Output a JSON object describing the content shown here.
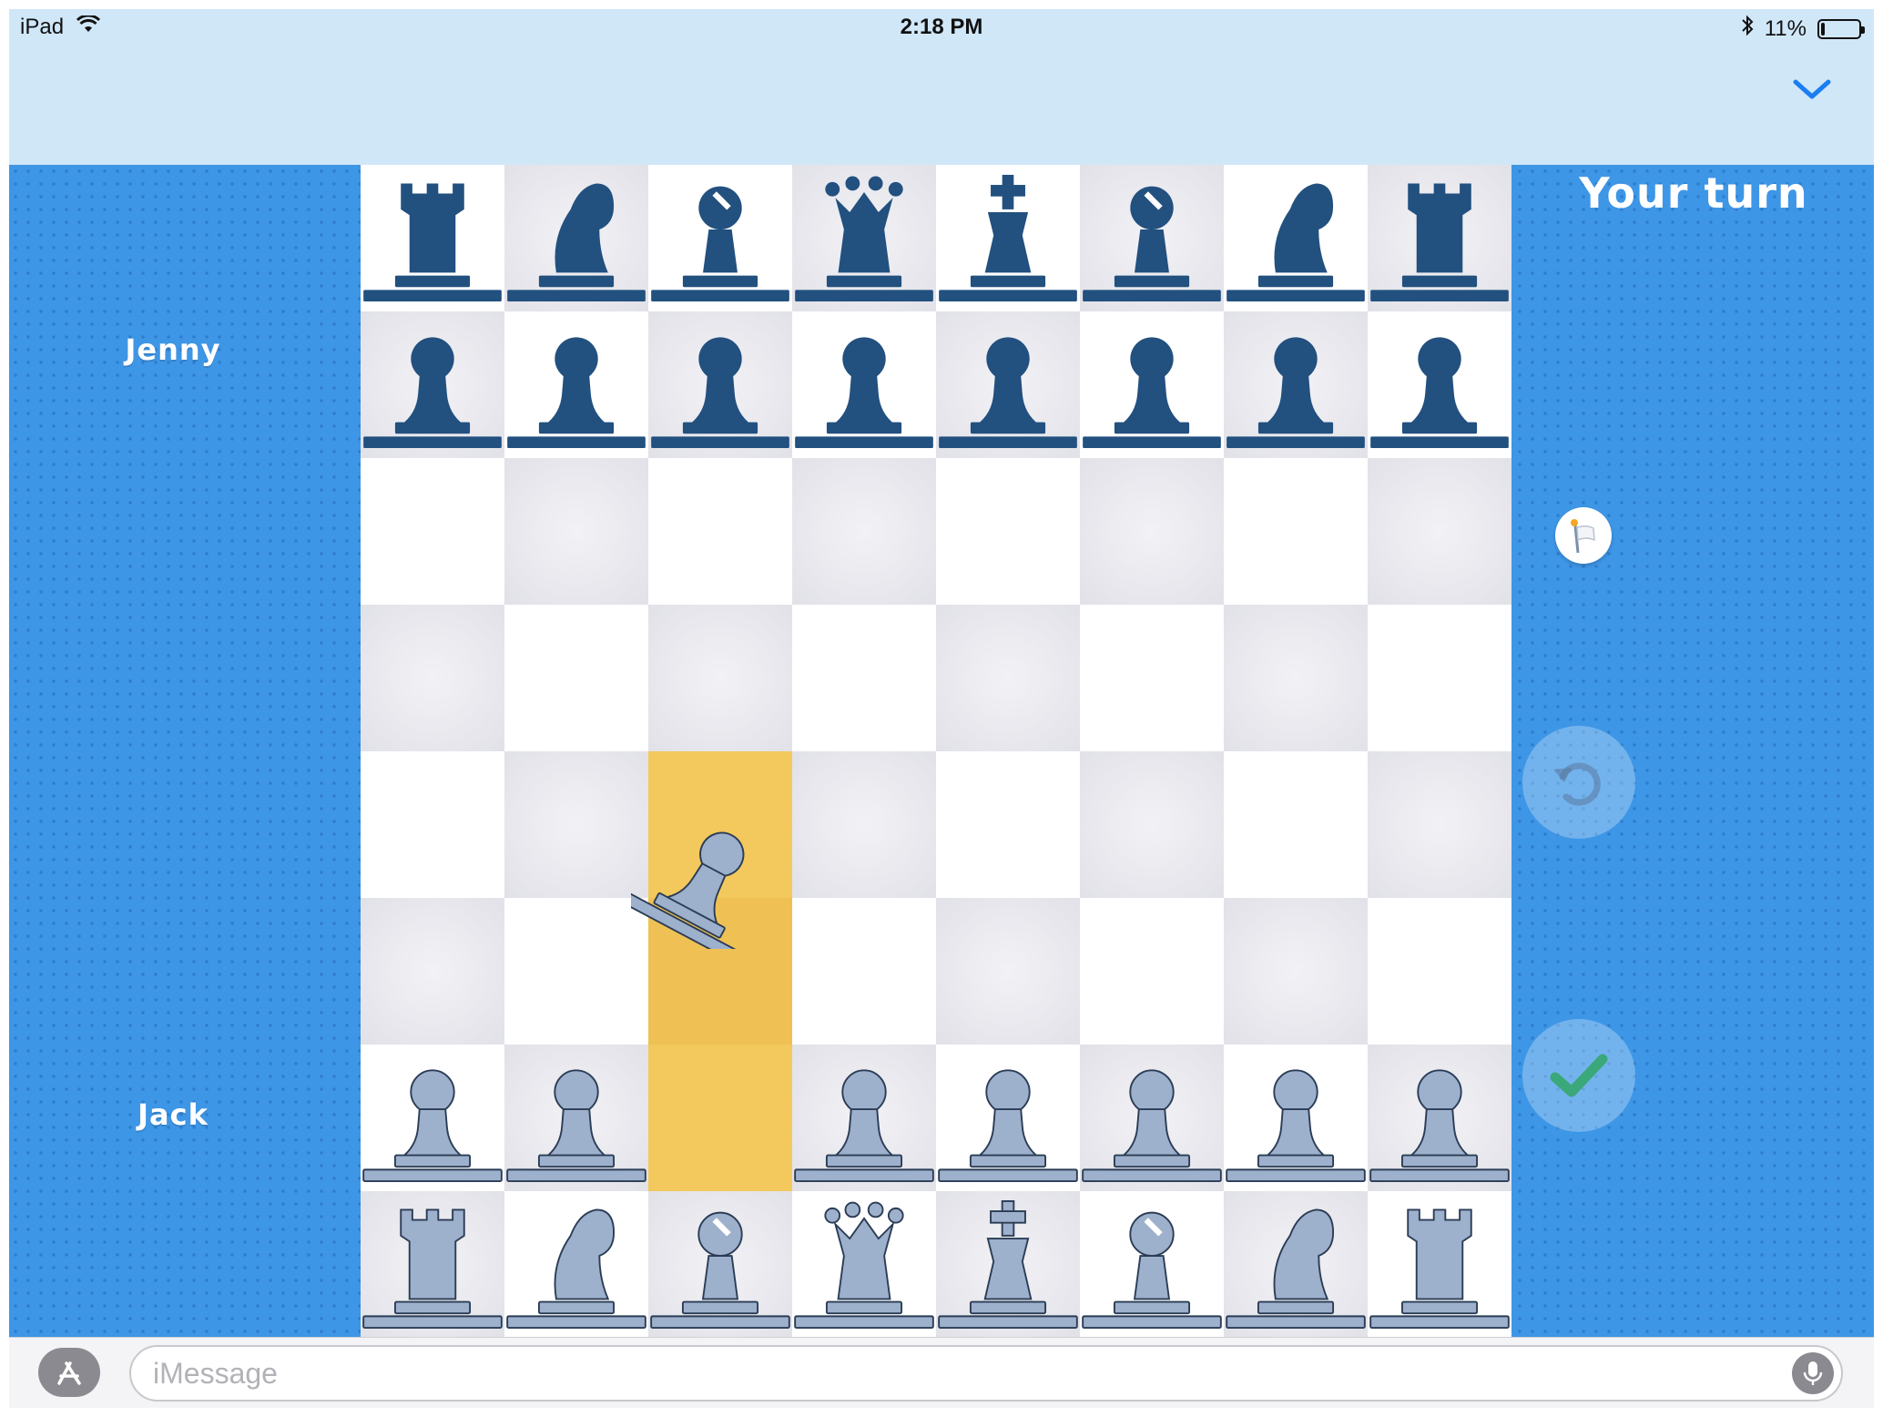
{
  "status_bar": {
    "device": "iPad",
    "time": "2:18 PM",
    "battery": "11%",
    "battery_level": 0.11,
    "icons": [
      "wifi-icon",
      "bluetooth-icon",
      "battery-icon"
    ]
  },
  "header": {
    "collapse_icon": "chevron-down-icon",
    "accent": "#1a7ef2"
  },
  "game": {
    "turn_label": "Your turn",
    "players": {
      "opponent": "Jenny",
      "self": "Jack"
    },
    "colors": {
      "background": "#3e96e6",
      "opponent_pieces": "#22507f",
      "self_pieces": "#9db0cc",
      "highlight": "#f3c85c",
      "confirm": "#3aa87a"
    },
    "board": {
      "rows": [
        [
          "bR",
          "bN",
          "bB",
          "bQ",
          "bK",
          "bB",
          "bN",
          "bR"
        ],
        [
          "bP",
          "bP",
          "bP",
          "bP",
          "bP",
          "bP",
          "bP",
          "bP"
        ],
        [
          "",
          "",
          "",
          "",
          "",
          "",
          "",
          ""
        ],
        [
          "",
          "",
          "",
          "",
          "",
          "",
          "",
          ""
        ],
        [
          "",
          "",
          "",
          "",
          "",
          "",
          "",
          ""
        ],
        [
          "",
          "",
          "",
          "",
          "",
          "",
          "",
          ""
        ],
        [
          "wP",
          "wP",
          "",
          "wP",
          "wP",
          "wP",
          "wP",
          "wP"
        ],
        [
          "wR",
          "wN",
          "wB",
          "wQ",
          "wK",
          "wB",
          "wN",
          "wR"
        ]
      ],
      "highlighted_squares": [
        [
          4,
          2
        ],
        [
          5,
          2
        ],
        [
          6,
          2
        ]
      ],
      "moving_piece": {
        "piece": "wP",
        "from": [
          6,
          2
        ],
        "to": [
          4,
          2
        ]
      }
    },
    "controls": {
      "resign_icon": "white-flag-icon",
      "undo_icon": "undo-icon",
      "confirm_icon": "checkmark-icon"
    }
  },
  "compose": {
    "app_store_icon": "app-store-icon",
    "placeholder": "iMessage",
    "mic_icon": "microphone-icon"
  }
}
